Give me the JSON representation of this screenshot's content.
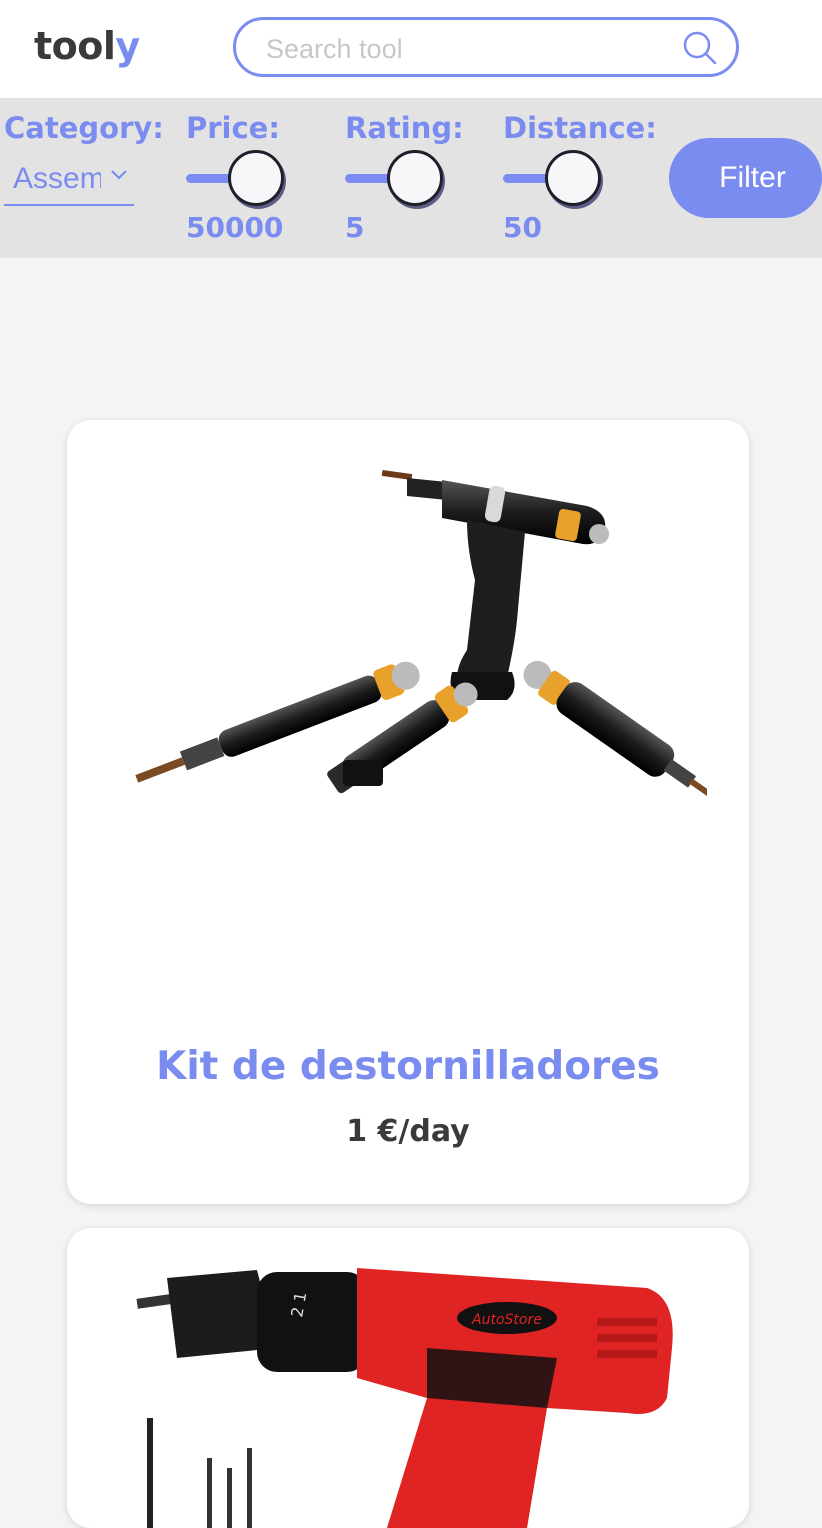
{
  "header": {
    "logo_main": "tool",
    "logo_accent": "y",
    "search": {
      "placeholder": "Search tool",
      "value": ""
    }
  },
  "filters": {
    "category": {
      "label": "Category:",
      "selected": "Assembly"
    },
    "price": {
      "label": "Price:",
      "value": "50000",
      "level": 0.75
    },
    "rating": {
      "label": "Rating:",
      "value": "5",
      "level": 0.75
    },
    "distance": {
      "label": "Distance:",
      "value": "50",
      "level": 0.75
    },
    "filter_button": "Filter"
  },
  "products": [
    {
      "title": "Kit de destornilladores",
      "price": "1 €/day",
      "image": "screwdriver-kit-image"
    },
    {
      "title": "",
      "price": "",
      "image": "cordless-drill-image"
    }
  ],
  "colors": {
    "accent": "#7b8cf0",
    "text_dark": "#3a3a3a",
    "filter_bg": "#e3e3e3",
    "page_bg": "#f4f4f4",
    "drill_red": "#e02323"
  }
}
